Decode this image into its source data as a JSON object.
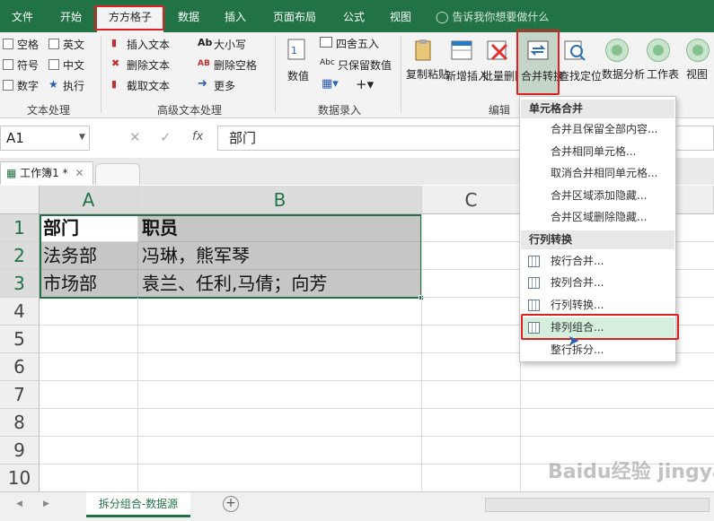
{
  "tabs": [
    "文件",
    "开始",
    "方方格子",
    "数据",
    "插入",
    "页面布局",
    "公式",
    "视图"
  ],
  "tell_me": "告诉我你想要做什么",
  "ribbon": {
    "text_proc": {
      "items": [
        "空格",
        "英文",
        "符号",
        "中文",
        "数字",
        "执行"
      ],
      "group_label": "文本处理"
    },
    "adv_text": {
      "items": [
        "插入文本",
        "删除文本",
        "截取文本",
        "大小写",
        "删除空格",
        "更多"
      ],
      "group_label": "高级文本处理"
    },
    "num_entry": {
      "items": [
        "数值",
        "四舍五入",
        "只保留数值"
      ],
      "group_label": "数据录入"
    },
    "edit": {
      "items": [
        "复制粘贴",
        "新增插入",
        "批量删除",
        "合并转换",
        "查找定位"
      ],
      "group_label": "编辑"
    },
    "right": {
      "items": [
        "数据分析",
        "工作表",
        "视图"
      ]
    }
  },
  "formula_bar": {
    "name_box": "A1",
    "fx": "fx",
    "value": "部门"
  },
  "workbook_tab": "工作簿1 *",
  "columns": [
    "A",
    "B",
    "C"
  ],
  "rows": [
    "1",
    "2",
    "3",
    "4",
    "5",
    "6",
    "7",
    "8",
    "9",
    "10"
  ],
  "cells": {
    "A1": "部门",
    "B1": "职员",
    "A2": "法务部",
    "B2": "冯琳，熊军琴",
    "A3": "市场部",
    "B3": "袁兰、任利,马倩；向芳"
  },
  "sheet_tab": "拆分组合-数据源",
  "dropdown": {
    "head1": "单元格合并",
    "group1": [
      "合并且保留全部内容...",
      "合并相同单元格...",
      "取消合并相同单元格...",
      "合并区域添加隐藏...",
      "合并区域删除隐藏..."
    ],
    "head2": "行列转换",
    "group2": [
      "按行合并...",
      "按列合并...",
      "行列转换...",
      "排列组合...",
      "整行拆分..."
    ]
  },
  "watermark": "Baidu经验 jingyan.baidu.com",
  "colors": {
    "accent": "#217346",
    "highlight": "#e02020",
    "menu_hover": "#d4f0dc"
  }
}
